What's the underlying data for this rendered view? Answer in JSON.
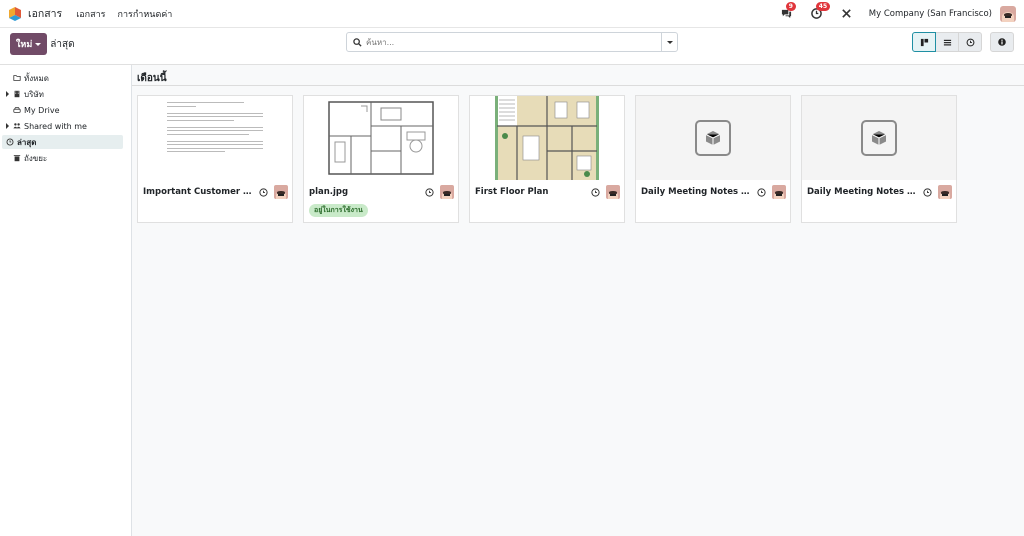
{
  "navbar": {
    "app_name": "เอกสาร",
    "menu": [
      "เอกสาร",
      "การกำหนดค่า"
    ],
    "messages_count": "9",
    "activities_count": "45",
    "company": "My Company (San Francisco)"
  },
  "control": {
    "new_label": "ใหม่",
    "breadcrumb": "ล่าสุด",
    "search_placeholder": "ค้นหา..."
  },
  "sidebar": {
    "items": [
      {
        "label": "ทั้งหมด",
        "icon": "folder-icon"
      },
      {
        "label": "บริษัท",
        "icon": "building-icon"
      },
      {
        "label": "My Drive",
        "icon": "drive-icon"
      },
      {
        "label": "Shared with me",
        "icon": "users-icon"
      },
      {
        "label": "ล่าสุด",
        "icon": "clock-icon"
      },
      {
        "label": "ถังขยะ",
        "icon": "trash-icon"
      }
    ]
  },
  "section": {
    "title": "เดือนนี้"
  },
  "cards": [
    {
      "name": "Important Customer Le...",
      "thumb": "document"
    },
    {
      "name": "plan.jpg",
      "thumb": "plan",
      "tag": "อยู่ในการใช้งาน"
    },
    {
      "name": "First Floor Plan",
      "thumb": "floor"
    },
    {
      "name": "Daily Meeting Notes (ye...",
      "thumb": "placeholder"
    },
    {
      "name": "Daily Meeting Notes (to...",
      "thumb": "placeholder"
    }
  ],
  "colors": {
    "brand": "#714b67",
    "active_view": "#1f8fa3",
    "badge": "#e0353b",
    "tag_bg": "#c9eac9"
  }
}
